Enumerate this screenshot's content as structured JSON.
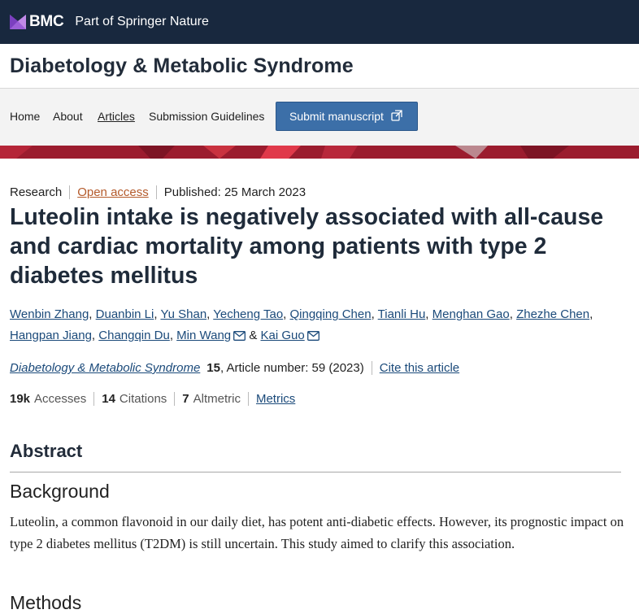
{
  "header": {
    "brand": "BMC",
    "parent": "Part of Springer Nature",
    "journal_title": "Diabetology & Metabolic Syndrome"
  },
  "nav": {
    "items": [
      "Home",
      "About",
      "Articles",
      "Submission Guidelines"
    ],
    "active": "Articles",
    "submit_label": "Submit manuscript"
  },
  "article": {
    "type": "Research",
    "access": "Open access",
    "published": "Published: 25 March 2023",
    "title": "Luteolin intake is negatively associated with all-cause and cardiac mortality among patients with type 2 diabetes mellitus",
    "authors": [
      "Wenbin Zhang",
      "Duanbin Li",
      "Yu Shan",
      "Yecheng Tao",
      "Qingqing Chen",
      "Tianli Hu",
      "Menghan Gao",
      "Zhezhe Chen",
      "Hangpan Jiang",
      "Changqin Du",
      "Min Wang",
      "Kai Guo"
    ],
    "author_sep": ",",
    "author_and": "&",
    "journal_name": "Diabetology & Metabolic Syndrome",
    "volume": "15",
    "article_number": ", Article number: 59 (2023)",
    "cite_label": "Cite this article"
  },
  "metrics": {
    "accesses_value": "19k",
    "accesses_label": "Accesses",
    "citations_value": "14",
    "citations_label": "Citations",
    "altmetric_value": "7",
    "altmetric_label": "Altmetric",
    "metrics_link": "Metrics"
  },
  "abstract": {
    "heading": "Abstract",
    "background_heading": "Background",
    "background_text": "Luteolin, a common flavonoid in our daily diet, has potent anti-diabetic effects. However, its prognostic impact on type 2 diabetes mellitus (T2DM) is still uncertain. This study aimed to clarify this association.",
    "next_heading": "Methods"
  },
  "colors": {
    "topbar": "#18283e",
    "banner": "#9b1c2e",
    "submit_button": "#3c6fa8",
    "link": "#1b4a7a",
    "open_access": "#b45a2b"
  },
  "icons": [
    "bmc-logo-icon",
    "external-link-icon",
    "mail-icon"
  ]
}
